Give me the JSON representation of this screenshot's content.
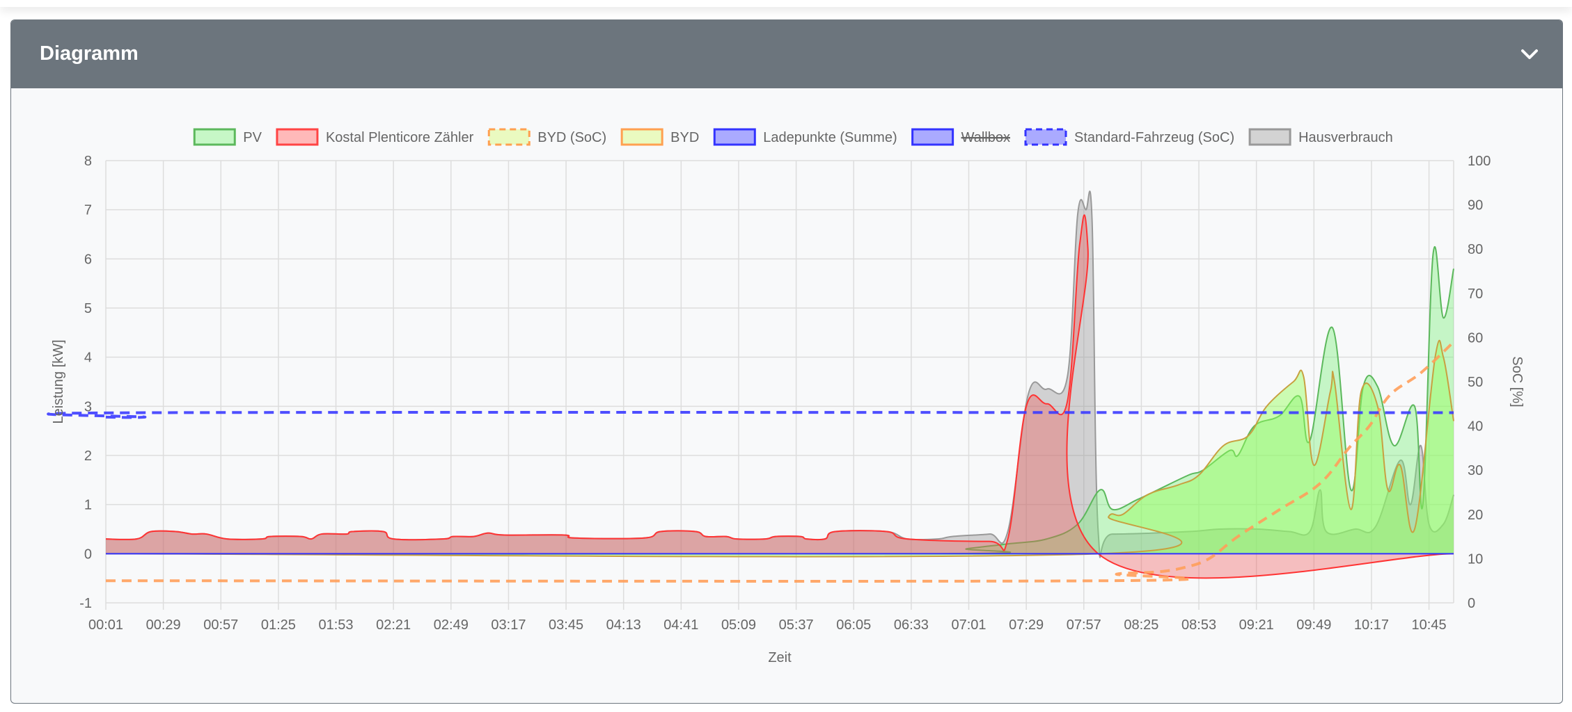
{
  "card": {
    "title": "Diagramm",
    "toggle_icon": "chevron-down-icon"
  },
  "chart_data": {
    "type": "line",
    "xlabel": "Zeit",
    "ylabel": "Leistung [kW]",
    "y2label": "SoC [%]",
    "x_unit": "minutes since 00:01",
    "xlim": [
      0,
      656
    ],
    "ylim": [
      -1,
      8
    ],
    "y2lim": [
      0,
      100
    ],
    "yticks": [
      "-1",
      "0",
      "1",
      "2",
      "3",
      "4",
      "5",
      "6",
      "7",
      "8"
    ],
    "y2ticks": [
      "0",
      "10",
      "20",
      "30",
      "40",
      "50",
      "60",
      "70",
      "80",
      "90",
      "100"
    ],
    "xticks": [
      "00:01",
      "00:29",
      "00:57",
      "01:25",
      "01:53",
      "02:21",
      "02:49",
      "03:17",
      "03:45",
      "04:13",
      "04:41",
      "05:09",
      "05:37",
      "06:05",
      "06:33",
      "07:01",
      "07:29",
      "07:57",
      "08:25",
      "08:53",
      "09:21",
      "09:49",
      "10:17",
      "10:45"
    ],
    "grid": true,
    "legend_position": "top",
    "legend": [
      {
        "label": "PV",
        "fill": "#c6f7c6",
        "stroke": "#5cb85c",
        "dashed": false,
        "hidden": false
      },
      {
        "label": "Kostal Plenticore Zähler",
        "fill": "#ffb9b9",
        "stroke": "#ff4444",
        "dashed": false,
        "hidden": false
      },
      {
        "label": "BYD (SoC)",
        "fill": "#eafac0",
        "stroke": "#ffa050",
        "dashed": true,
        "hidden": false
      },
      {
        "label": "BYD",
        "fill": "#eafac0",
        "stroke": "#ffa050",
        "dashed": false,
        "hidden": false
      },
      {
        "label": "Ladepunkte (Summe)",
        "fill": "#aaaaff",
        "stroke": "#3333ff",
        "dashed": false,
        "hidden": false
      },
      {
        "label": "Wallbox",
        "fill": "#aaaaff",
        "stroke": "#3333ff",
        "dashed": false,
        "hidden": true
      },
      {
        "label": "Standard-Fahrzeug (SoC)",
        "fill": "#aaaaff",
        "stroke": "#3333ff",
        "dashed": true,
        "hidden": false
      },
      {
        "label": "Hausverbrauch",
        "fill": "#d3d3d3",
        "stroke": "#999999",
        "dashed": false,
        "hidden": false
      }
    ],
    "series": [
      {
        "name": "Hausverbrauch",
        "axis": "left",
        "type": "area",
        "fill": "rgba(150,150,150,0.40)",
        "stroke": "#999999",
        "points": [
          [
            0,
            0.3
          ],
          [
            15,
            0.3
          ],
          [
            22,
            0.45
          ],
          [
            34,
            0.45
          ],
          [
            42,
            0.4
          ],
          [
            49,
            0.4
          ],
          [
            59,
            0.3
          ],
          [
            76,
            0.3
          ],
          [
            80,
            0.35
          ],
          [
            95,
            0.35
          ],
          [
            100,
            0.3
          ],
          [
            105,
            0.4
          ],
          [
            117,
            0.4
          ],
          [
            120,
            0.45
          ],
          [
            135,
            0.45
          ],
          [
            140,
            0.3
          ],
          [
            164,
            0.3
          ],
          [
            169,
            0.35
          ],
          [
            179,
            0.35
          ],
          [
            186,
            0.42
          ],
          [
            194,
            0.38
          ],
          [
            223,
            0.38
          ],
          [
            228,
            0.32
          ],
          [
            262,
            0.32
          ],
          [
            270,
            0.45
          ],
          [
            287,
            0.45
          ],
          [
            292,
            0.35
          ],
          [
            302,
            0.35
          ],
          [
            307,
            0.3
          ],
          [
            321,
            0.3
          ],
          [
            326,
            0.35
          ],
          [
            338,
            0.35
          ],
          [
            341,
            0.3
          ],
          [
            350,
            0.3
          ],
          [
            355,
            0.45
          ],
          [
            380,
            0.45
          ],
          [
            390,
            0.3
          ],
          [
            405,
            0.3
          ],
          [
            412,
            0.35
          ],
          [
            430,
            0.4
          ],
          [
            439,
            0.45
          ],
          [
            449,
            3.25
          ],
          [
            458,
            3.35
          ],
          [
            468,
            3.6
          ],
          [
            473,
            6.9
          ],
          [
            477,
            7.0
          ],
          [
            480,
            6.8
          ],
          [
            483,
            0.45
          ],
          [
            490,
            0.4
          ],
          [
            527,
            0.45
          ],
          [
            542,
            0.5
          ],
          [
            561,
            0.5
          ],
          [
            576,
            0.45
          ],
          [
            586,
            0.45
          ],
          [
            591,
            1.3
          ],
          [
            594,
            0.45
          ],
          [
            608,
            0.5
          ],
          [
            618,
            0.55
          ],
          [
            630,
            1.9
          ],
          [
            635,
            1.0
          ],
          [
            640,
            2.2
          ],
          [
            644,
            0.6
          ],
          [
            651,
            0.6
          ],
          [
            656,
            1.2
          ]
        ]
      },
      {
        "name": "PV",
        "axis": "left",
        "type": "area",
        "fill": "rgba(120,240,120,0.40)",
        "stroke": "#5cb85c",
        "points": [
          [
            0,
            0
          ],
          [
            404,
            0
          ],
          [
            419,
            0.1
          ],
          [
            439,
            0.2
          ],
          [
            458,
            0.3
          ],
          [
            473,
            0.6
          ],
          [
            484,
            1.3
          ],
          [
            490,
            0.9
          ],
          [
            502,
            1.1
          ],
          [
            512,
            1.3
          ],
          [
            527,
            1.6
          ],
          [
            534,
            1.7
          ],
          [
            547,
            2.1
          ],
          [
            551,
            2.0
          ],
          [
            559,
            2.6
          ],
          [
            571,
            2.8
          ],
          [
            581,
            3.2
          ],
          [
            586,
            2.3
          ],
          [
            597,
            4.6
          ],
          [
            606,
            1.3
          ],
          [
            612,
            3.4
          ],
          [
            619,
            3.4
          ],
          [
            627,
            2.2
          ],
          [
            637,
            3.0
          ],
          [
            641,
            1.0
          ],
          [
            646,
            6.1
          ],
          [
            651,
            4.8
          ],
          [
            656,
            5.8
          ]
        ]
      },
      {
        "name": "BYD",
        "axis": "left",
        "type": "area",
        "fill": "rgba(150,255,90,0.45)",
        "stroke": "#c8a040",
        "points": [
          [
            0,
            0
          ],
          [
            484,
            0
          ],
          [
            488,
            0.75
          ],
          [
            495,
            0.8
          ],
          [
            507,
            1.2
          ],
          [
            522,
            1.4
          ],
          [
            532,
            1.6
          ],
          [
            544,
            2.2
          ],
          [
            556,
            2.4
          ],
          [
            565,
            3.0
          ],
          [
            578,
            3.5
          ],
          [
            583,
            3.6
          ],
          [
            588,
            1.8
          ],
          [
            596,
            3.3
          ],
          [
            598,
            3.5
          ],
          [
            606,
            0.9
          ],
          [
            611,
            3.3
          ],
          [
            619,
            3.0
          ],
          [
            624,
            1.3
          ],
          [
            630,
            1.8
          ],
          [
            637,
            0.5
          ],
          [
            647,
            4.0
          ],
          [
            651,
            4.0
          ],
          [
            656,
            2.7
          ]
        ]
      },
      {
        "name": "Kostal Plenticore Zähler",
        "axis": "left",
        "type": "area",
        "fill": "rgba(240,80,80,0.35)",
        "stroke": "#ff3333",
        "points": [
          [
            0,
            0.3
          ],
          [
            15,
            0.3
          ],
          [
            22,
            0.45
          ],
          [
            34,
            0.45
          ],
          [
            42,
            0.4
          ],
          [
            49,
            0.4
          ],
          [
            59,
            0.3
          ],
          [
            76,
            0.3
          ],
          [
            80,
            0.35
          ],
          [
            95,
            0.35
          ],
          [
            100,
            0.3
          ],
          [
            105,
            0.4
          ],
          [
            117,
            0.4
          ],
          [
            120,
            0.45
          ],
          [
            135,
            0.45
          ],
          [
            140,
            0.3
          ],
          [
            164,
            0.3
          ],
          [
            169,
            0.35
          ],
          [
            179,
            0.35
          ],
          [
            186,
            0.42
          ],
          [
            194,
            0.38
          ],
          [
            223,
            0.38
          ],
          [
            228,
            0.32
          ],
          [
            262,
            0.32
          ],
          [
            270,
            0.45
          ],
          [
            287,
            0.45
          ],
          [
            292,
            0.35
          ],
          [
            302,
            0.35
          ],
          [
            307,
            0.3
          ],
          [
            321,
            0.3
          ],
          [
            326,
            0.35
          ],
          [
            338,
            0.35
          ],
          [
            341,
            0.3
          ],
          [
            350,
            0.3
          ],
          [
            355,
            0.45
          ],
          [
            380,
            0.45
          ],
          [
            390,
            0.3
          ],
          [
            430,
            0.25
          ],
          [
            439,
            0.3
          ],
          [
            448,
            3.0
          ],
          [
            458,
            3.05
          ],
          [
            468,
            3.1
          ],
          [
            474,
            6.3
          ],
          [
            478,
            6.2
          ],
          [
            483,
            0
          ],
          [
            656,
            0
          ]
        ]
      },
      {
        "name": "Ladepunkte (Summe)",
        "axis": "left",
        "type": "line",
        "stroke": "#3333ff",
        "points": [
          [
            0,
            0
          ],
          [
            656,
            0
          ]
        ]
      },
      {
        "name": "BYD (SoC)",
        "axis": "right",
        "type": "dashed",
        "stroke": "#ff9f5a",
        "points": [
          [
            0,
            5
          ],
          [
            488,
            5
          ],
          [
            492,
            6.5
          ],
          [
            512,
            7
          ],
          [
            525,
            8
          ],
          [
            537,
            10
          ],
          [
            551,
            15
          ],
          [
            571,
            21
          ],
          [
            591,
            27
          ],
          [
            605,
            35
          ],
          [
            615,
            40
          ],
          [
            625,
            47
          ],
          [
            640,
            52
          ],
          [
            656,
            59
          ]
        ]
      },
      {
        "name": "Standard-Fahrzeug (SoC)",
        "axis": "right",
        "type": "dashed",
        "stroke": "#3b3bff",
        "points": [
          [
            0,
            42
          ],
          [
            19,
            42
          ],
          [
            23,
            43
          ],
          [
            656,
            43
          ]
        ]
      }
    ]
  }
}
